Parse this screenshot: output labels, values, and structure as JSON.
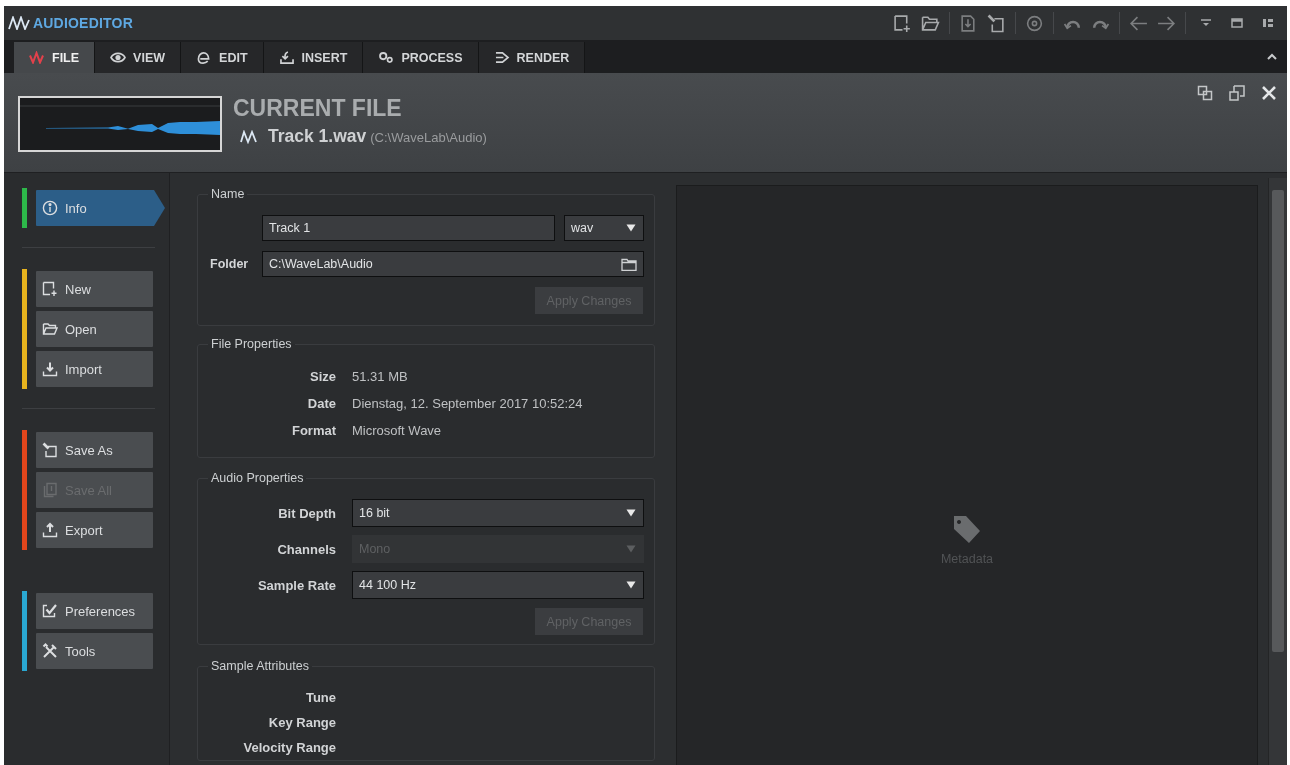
{
  "app": {
    "title": "AUDIOEDITOR"
  },
  "tabs": [
    {
      "label": "FILE",
      "selected": true
    },
    {
      "label": "VIEW",
      "selected": false
    },
    {
      "label": "EDIT",
      "selected": false
    },
    {
      "label": "INSERT",
      "selected": false
    },
    {
      "label": "PROCESS",
      "selected": false
    },
    {
      "label": "RENDER",
      "selected": false
    }
  ],
  "header": {
    "title": "CURRENT FILE",
    "file_name": "Track 1.wav",
    "file_path": "(C:\\WaveLab\\Audio)"
  },
  "sidebar": {
    "groups": [
      {
        "color": "#2db84a",
        "items": [
          {
            "label": "Info",
            "selected": true,
            "disabled": false
          }
        ]
      },
      {
        "color": "#e8b41e",
        "items": [
          {
            "label": "New",
            "selected": false,
            "disabled": false
          },
          {
            "label": "Open",
            "selected": false,
            "disabled": false
          },
          {
            "label": "Import",
            "selected": false,
            "disabled": false
          }
        ]
      },
      {
        "color": "#e2461c",
        "items": [
          {
            "label": "Save As",
            "selected": false,
            "disabled": false
          },
          {
            "label": "Save All",
            "selected": false,
            "disabled": true
          },
          {
            "label": "Export",
            "selected": false,
            "disabled": false
          }
        ]
      },
      {
        "color": "#2aa8d2",
        "items": [
          {
            "label": "Preferences",
            "selected": false,
            "disabled": false
          },
          {
            "label": "Tools",
            "selected": false,
            "disabled": false
          }
        ]
      }
    ]
  },
  "name_section": {
    "title": "Name",
    "file_name": {
      "value": "Track 1"
    },
    "extension": {
      "value": "wav"
    },
    "folder": {
      "label": "Folder",
      "value": "C:\\WaveLab\\Audio"
    },
    "apply_button": {
      "label": "Apply Changes",
      "disabled": true
    }
  },
  "file_properties": {
    "title": "File Properties",
    "rows": [
      {
        "label": "Size",
        "value": "51.31 MB"
      },
      {
        "label": "Date",
        "value": "Dienstag, 12. September 2017 10:52:24"
      },
      {
        "label": "Format",
        "value": "Microsoft Wave"
      }
    ]
  },
  "audio_properties": {
    "title": "Audio Properties",
    "fields": [
      {
        "label": "Bit Depth",
        "value": "16 bit",
        "disabled": false
      },
      {
        "label": "Channels",
        "value": "Mono",
        "disabled": true
      },
      {
        "label": "Sample Rate",
        "value": "44 100 Hz",
        "disabled": false
      }
    ],
    "apply_button": {
      "label": "Apply Changes",
      "disabled": true
    }
  },
  "sample_attributes": {
    "title": "Sample Attributes",
    "labels": [
      "Tune",
      "Key Range",
      "Velocity Range"
    ]
  },
  "metadata_panel": {
    "label": "Metadata"
  }
}
